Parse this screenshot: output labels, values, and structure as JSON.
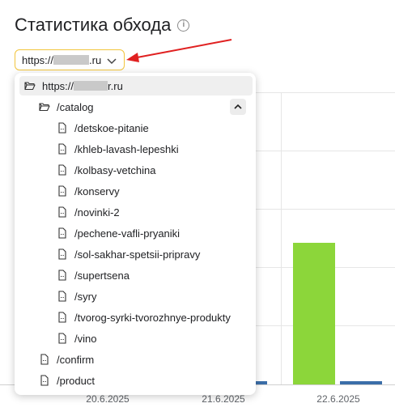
{
  "page": {
    "title": "Статистика обхода"
  },
  "site_select": {
    "prefix": "https://",
    "suffix": ".ru"
  },
  "dropdown": {
    "root": {
      "prefix": "https://",
      "suffix": "r.ru"
    },
    "catalog": "/catalog",
    "children": [
      "/detskoe-pitanie",
      "/khleb-lavash-lepeshki",
      "/kolbasy-vetchina",
      "/konservy",
      "/novinki-2",
      "/pechene-vafli-pryaniki",
      "/sol-sakhar-spetsii-pripravy",
      "/supertsena",
      "/syry",
      "/tvorog-syrki-tvorozhnye-produkty",
      "/vino"
    ],
    "others": [
      "/confirm",
      "/product"
    ]
  },
  "colors": {
    "accent_border": "#f2c53d",
    "arrow": "#e02020",
    "bar_green": "#8cd63a",
    "bar_blue": "#3b6ea8"
  },
  "chart_data": {
    "type": "bar",
    "categories": [
      "20.6.2025",
      "21.6.2025",
      "22.6.2025"
    ],
    "series": [
      {
        "values": [
          0,
          1,
          48
        ]
      },
      {
        "values": [
          1,
          1,
          1
        ]
      }
    ],
    "grid": true
  }
}
